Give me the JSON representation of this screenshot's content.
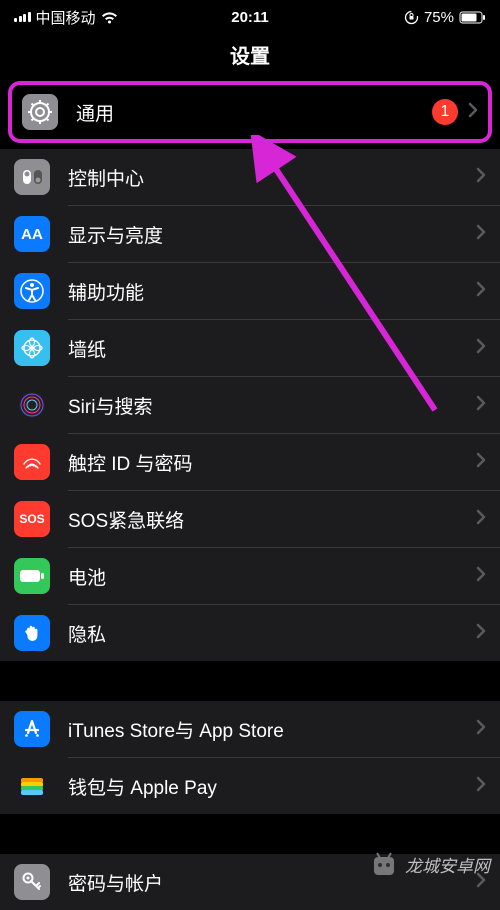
{
  "status_bar": {
    "carrier": "中国移动",
    "time": "20:11",
    "battery_percent": "75%"
  },
  "nav": {
    "title": "设置"
  },
  "rows": {
    "general": {
      "label": "通用",
      "badge": "1"
    },
    "control_center": {
      "label": "控制中心"
    },
    "display": {
      "label": "显示与亮度"
    },
    "accessibility": {
      "label": "辅助功能"
    },
    "wallpaper": {
      "label": "墙纸"
    },
    "siri": {
      "label": "Siri与搜索"
    },
    "touchid": {
      "label": "触控 ID 与密码"
    },
    "sos": {
      "label": "SOS紧急联络",
      "icon_text": "SOS"
    },
    "battery": {
      "label": "电池"
    },
    "privacy": {
      "label": "隐私"
    },
    "appstore": {
      "label": "iTunes Store与 App Store"
    },
    "wallet": {
      "label": "钱包与 Apple Pay"
    },
    "passwords": {
      "label": "密码与帐户"
    }
  },
  "watermark": {
    "text": "龙城安卓网"
  },
  "annotation": {
    "highlight_color": "#d626d6"
  }
}
